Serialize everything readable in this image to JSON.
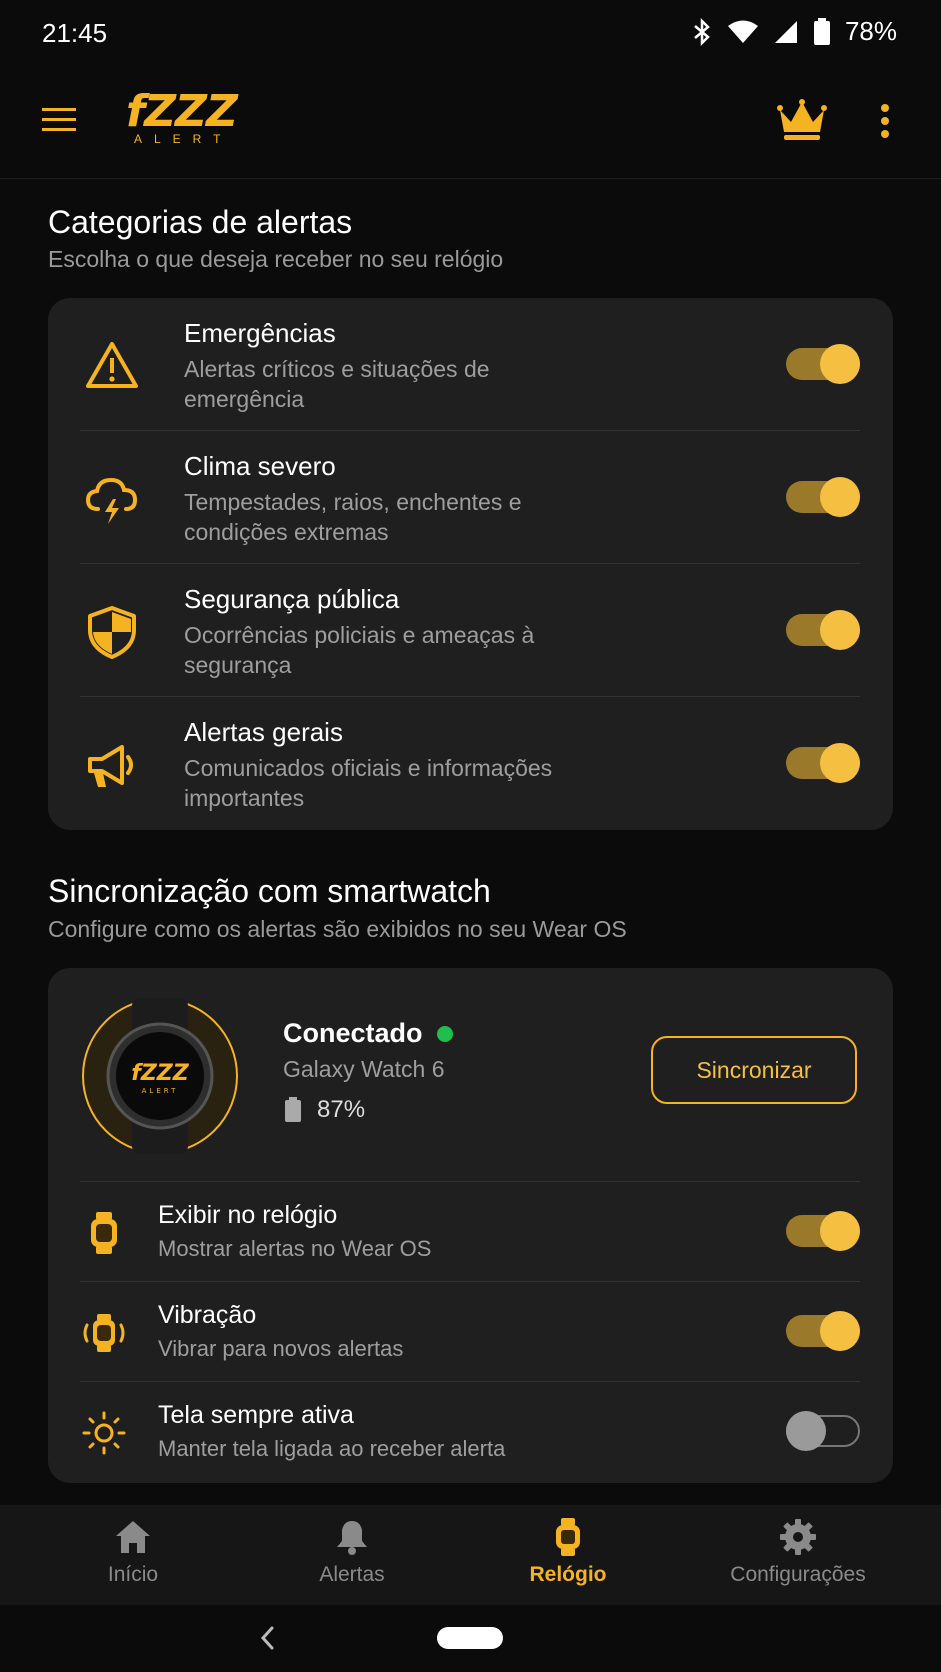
{
  "status_bar": {
    "time": "21:45",
    "battery": "78%"
  },
  "app_bar": {
    "logo_text": "fZZZ",
    "logo_sub": "ALERT"
  },
  "categories": {
    "title": "Categorias de alertas",
    "subtitle": "Escolha o que deseja receber no seu relógio",
    "items": [
      {
        "title": "Emergências",
        "desc": "Alertas críticos e situações de emergência",
        "enabled": true,
        "icon": "warning-icon"
      },
      {
        "title": "Clima severo",
        "desc": "Tempestades, raios, enchentes e condições extremas",
        "enabled": true,
        "icon": "storm-icon"
      },
      {
        "title": "Segurança pública",
        "desc": "Ocorrências policiais e ameaças à segurança",
        "enabled": true,
        "icon": "shield-icon"
      },
      {
        "title": "Alertas gerais",
        "desc": "Comunicados oficiais e informações importantes",
        "enabled": true,
        "icon": "megaphone-icon"
      }
    ]
  },
  "sync": {
    "title": "Sincronização com smartwatch",
    "subtitle": "Configure como os alertas são exibidos no seu Wear OS",
    "status": "Conectado",
    "model": "Galaxy Watch 6",
    "battery": "87%",
    "sync_button": "Sincronizar",
    "watch_logo": "fZZZ",
    "watch_logo_sub": "ALERT",
    "settings": [
      {
        "title": "Exibir no relógio",
        "desc": "Mostrar alertas no Wear OS",
        "enabled": true,
        "icon": "watch-icon"
      },
      {
        "title": "Vibração",
        "desc": "Vibrar para novos alertas",
        "enabled": true,
        "icon": "vibrate-icon"
      },
      {
        "title": "Tela sempre ativa",
        "desc": "Manter tela ligada ao receber alerta",
        "enabled": false,
        "icon": "brightness-icon"
      }
    ]
  },
  "nav": {
    "items": [
      {
        "label": "Início",
        "icon": "home-icon"
      },
      {
        "label": "Alertas",
        "icon": "bell-icon"
      },
      {
        "label": "Relógio",
        "icon": "watch-icon",
        "active": true
      },
      {
        "label": "Configurações",
        "icon": "gear-icon"
      }
    ]
  },
  "colors": {
    "accent": "#f5b321",
    "background": "#0b0b0b",
    "card": "#1f1f1f",
    "connected": "#1fbf4f"
  }
}
